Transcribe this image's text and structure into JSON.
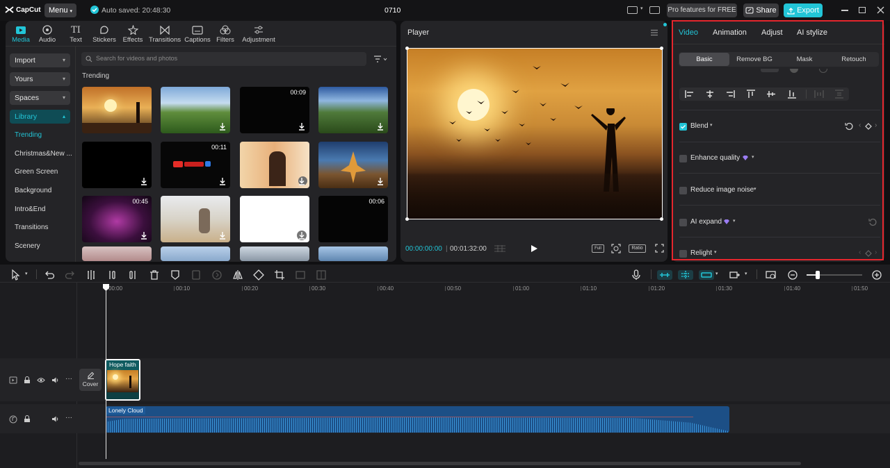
{
  "app": {
    "logo": "CapCut",
    "menu_label": "Menu",
    "autosave": "Auto saved: 20:48:30",
    "project_name": "0710",
    "pro_label": "Pro features for FREE",
    "share_label": "Share",
    "export_label": "Export"
  },
  "media_tabs": [
    "Media",
    "Audio",
    "Text",
    "Stickers",
    "Effects",
    "Transitions",
    "Captions",
    "Filters",
    "Adjustment"
  ],
  "sidebar": {
    "buttons": [
      "Import",
      "Yours",
      "Spaces",
      "Library"
    ],
    "items": [
      "Trending",
      "Christmas&New ...",
      "Green Screen",
      "Background",
      "Intro&End",
      "Transitions",
      "Scenery"
    ]
  },
  "search": {
    "placeholder": "Search for videos and photos"
  },
  "section_title": "Trending",
  "thumbs": [
    {
      "duration": ""
    },
    {
      "duration": ""
    },
    {
      "duration": "00:09"
    },
    {
      "duration": ""
    },
    {
      "duration": ""
    },
    {
      "duration": "00:11"
    },
    {
      "duration": ""
    },
    {
      "duration": ""
    },
    {
      "duration": "00:45"
    },
    {
      "duration": ""
    },
    {
      "duration": ""
    },
    {
      "duration": "00:06"
    }
  ],
  "player": {
    "title": "Player",
    "current_time": "00:00:00:00",
    "total_time": "00:01:32:00",
    "full_label": "Full",
    "ratio_label": "Ratio"
  },
  "inspector": {
    "tabs": [
      "Video",
      "Animation",
      "Adjust",
      "AI stylize"
    ],
    "subtabs": [
      "Basic",
      "Remove BG",
      "Mask",
      "Retouch"
    ],
    "options": [
      "Blend",
      "Enhance quality",
      "Reduce image noise",
      "AI expand",
      "Relight"
    ]
  },
  "timeline": {
    "ruler": [
      "00:00",
      "00:10",
      "00:20",
      "00:30",
      "00:40",
      "00:50",
      "01:00",
      "01:10",
      "01:20",
      "01:30",
      "01:40",
      "01:50"
    ],
    "cover_label": "Cover",
    "video_clip": "Hope faith",
    "audio_clip": "Lonely Cloud"
  },
  "colors": {
    "accent": "#22c5d7",
    "highlight_border": "#e5262d",
    "audio_clip": "#1c4f86"
  }
}
